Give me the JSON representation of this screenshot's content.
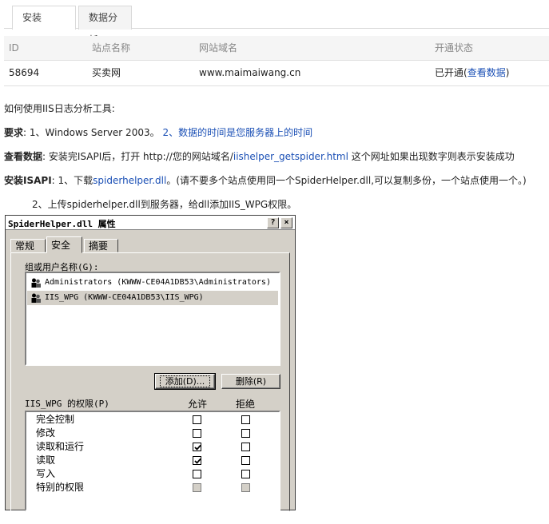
{
  "tabs": [
    {
      "label": "安装ISAPI",
      "active": true
    },
    {
      "label": "数据分析",
      "active": false
    }
  ],
  "table": {
    "headers": [
      "ID",
      "站点名称",
      "网站域名",
      "开通状态"
    ],
    "row": {
      "id": "58694",
      "name": "买卖网",
      "domain": "www.maimaiwang.cn",
      "status": "已开通(",
      "status_link": "查看数据",
      "status_close": ")"
    }
  },
  "guide": {
    "title": "如何使用IIS日志分析工具:",
    "req_label": "要求",
    "req_text": ": 1、Windows Server 2003。",
    "req_blue": "2、数据的时间是您服务器上的时间",
    "view_label": "查看数据",
    "view_text": ": 安装完ISAPI后，打开 http://您的网站域名/",
    "view_link": "iishelper_getspider.html",
    "view_tail": " 这个网址如果出现数字则表示安装成功",
    "install_label": "安装ISAPI",
    "install_text": ": 1、下载",
    "install_link": "spiderhelper.dll",
    "install_tail": "。(请不要多个站点使用同一个SpiderHelper.dll,可以复制多份，一个站点使用一个。)",
    "step2": "2、上传spiderhelper.dll到服务器，给dll添加IIS_WPG权限。"
  },
  "dialog": {
    "title": "SpiderHelper.dll 属性",
    "help_btn": "?",
    "close_btn": "×",
    "tabs": [
      "常规",
      "安全",
      "摘要"
    ],
    "group_label": "组或用户名称(G):",
    "users": [
      "Administrators (KWWW-CE04A1DB53\\Administrators)",
      "IIS_WPG (KWWW-CE04A1DB53\\IIS_WPG)"
    ],
    "add_btn": "添加(D)...",
    "remove_btn": "删除(R)",
    "perm_label": "IIS_WPG 的权限(P)",
    "allow_label": "允许",
    "deny_label": "拒绝",
    "permissions": [
      {
        "name": "完全控制",
        "allow": false,
        "deny": false
      },
      {
        "name": "修改",
        "allow": false,
        "deny": false
      },
      {
        "name": "读取和运行",
        "allow": true,
        "deny": false
      },
      {
        "name": "读取",
        "allow": true,
        "deny": false
      },
      {
        "name": "写入",
        "allow": false,
        "deny": false
      },
      {
        "name": "特别的权限",
        "allow": false,
        "deny": false,
        "disabled": true
      }
    ]
  }
}
